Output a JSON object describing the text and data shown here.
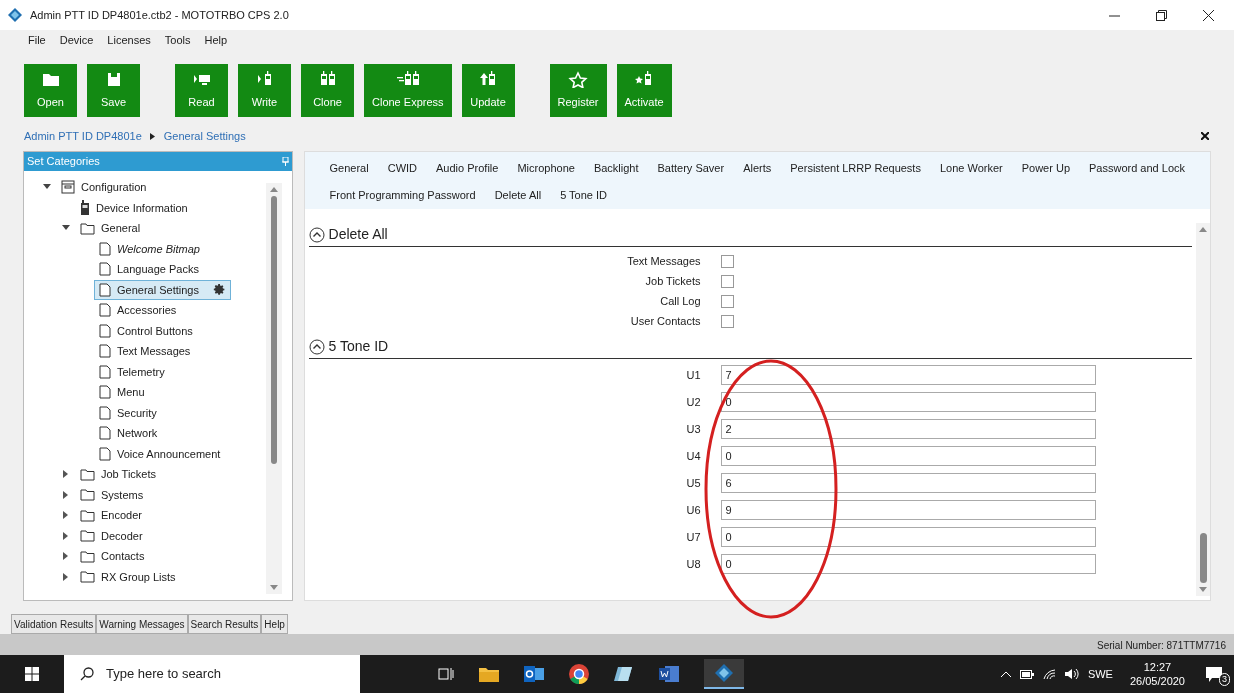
{
  "window": {
    "title": "Admin PTT ID DP4801e.ctb2 - MOTOTRBO CPS 2.0"
  },
  "menu": [
    "File",
    "Device",
    "Licenses",
    "Tools",
    "Help"
  ],
  "toolbar": [
    [
      {
        "kind": "open",
        "label": "Open"
      },
      {
        "kind": "save",
        "label": "Save"
      }
    ],
    [
      {
        "kind": "read",
        "label": "Read"
      },
      {
        "kind": "write",
        "label": "Write"
      },
      {
        "kind": "clone",
        "label": "Clone"
      },
      {
        "kind": "clone-express",
        "label": "Clone Express"
      },
      {
        "kind": "update",
        "label": "Update"
      }
    ],
    [
      {
        "kind": "register",
        "label": "Register"
      },
      {
        "kind": "activate",
        "label": "Activate"
      }
    ]
  ],
  "breadcrumb": [
    "Admin PTT ID DP4801e",
    "General Settings"
  ],
  "categories": {
    "title": "Set Categories",
    "tree": [
      {
        "kind": "root",
        "label": "Configuration",
        "expanded": true,
        "children": [
          {
            "kind": "device",
            "label": "Device Information"
          },
          {
            "kind": "folder",
            "label": "General",
            "expanded": true,
            "children": [
              {
                "kind": "page",
                "label": "Welcome Bitmap",
                "italic": true,
                "selected": false
              },
              {
                "kind": "page",
                "label": "Language Packs",
                "italic": false,
                "selected": false
              },
              {
                "kind": "page",
                "label": "General Settings",
                "italic": false,
                "selected": true
              },
              {
                "kind": "page",
                "label": "Accessories",
                "italic": false,
                "selected": false
              },
              {
                "kind": "page",
                "label": "Control Buttons",
                "italic": false,
                "selected": false
              },
              {
                "kind": "page",
                "label": "Text Messages",
                "italic": false,
                "selected": false
              },
              {
                "kind": "page",
                "label": "Telemetry",
                "italic": false,
                "selected": false
              },
              {
                "kind": "page",
                "label": "Menu",
                "italic": false,
                "selected": false
              },
              {
                "kind": "page",
                "label": "Security",
                "italic": false,
                "selected": false
              },
              {
                "kind": "page",
                "label": "Network",
                "italic": false,
                "selected": false
              },
              {
                "kind": "page",
                "label": "Voice Announcement",
                "italic": false,
                "selected": false
              }
            ]
          },
          {
            "kind": "folder",
            "label": "Job Tickets",
            "expanded": false
          },
          {
            "kind": "folder",
            "label": "Systems",
            "expanded": false
          },
          {
            "kind": "folder",
            "label": "Encoder",
            "expanded": false
          },
          {
            "kind": "folder",
            "label": "Decoder",
            "expanded": false
          },
          {
            "kind": "folder",
            "label": "Contacts",
            "expanded": false
          },
          {
            "kind": "folder",
            "label": "RX Group Lists",
            "expanded": false
          }
        ]
      }
    ]
  },
  "section_tabs": [
    [
      "General",
      "CWID",
      "Audio Profile",
      "Microphone",
      "Backlight",
      "Battery Saver",
      "Alerts",
      "Persistent LRRP Requests",
      "Lone Worker",
      "Power Up",
      "Password and Lock"
    ],
    [
      "Front Programming Password",
      "Delete All",
      "5 Tone ID"
    ]
  ],
  "sections": [
    {
      "title": "Delete All",
      "kind": "checkboxes",
      "expanded": true,
      "items": [
        {
          "label": "Text Messages",
          "checked": false
        },
        {
          "label": "Job Tickets",
          "checked": false
        },
        {
          "label": "Call Log",
          "checked": false
        },
        {
          "label": "User Contacts",
          "checked": false
        }
      ]
    },
    {
      "title": "5 Tone ID",
      "kind": "fields",
      "expanded": true,
      "items": [
        {
          "label": "U1",
          "value": "7"
        },
        {
          "label": "U2",
          "value": "0"
        },
        {
          "label": "U3",
          "value": "2"
        },
        {
          "label": "U4",
          "value": "0"
        },
        {
          "label": "U5",
          "value": "6"
        },
        {
          "label": "U6",
          "value": "9"
        },
        {
          "label": "U7",
          "value": "0"
        },
        {
          "label": "U8",
          "value": "0"
        }
      ]
    }
  ],
  "bottom_tabs": [
    "Validation Results",
    "Warning Messages",
    "Search Results",
    "Help"
  ],
  "status_bar": {
    "serial": "Serial Number: 871TTM7716"
  },
  "taskbar": {
    "search_placeholder": "Type here to search",
    "language": "SWE",
    "time": "12:27",
    "date": "26/05/2020",
    "notifications": "3"
  }
}
